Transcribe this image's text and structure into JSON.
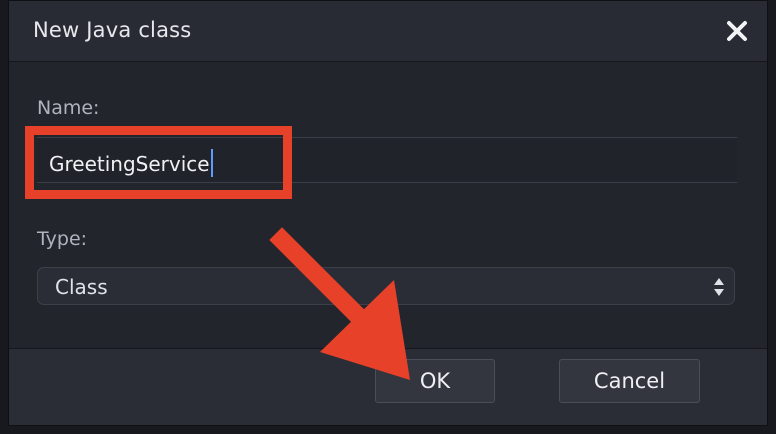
{
  "dialog": {
    "title": "New Java class",
    "close_icon": "close-icon"
  },
  "form": {
    "name_label": "Name:",
    "name_value": "GreetingService",
    "type_label": "Type:",
    "type_value": "Class",
    "type_icon": "select-arrows-icon"
  },
  "buttons": {
    "ok_label": "OK",
    "cancel_label": "Cancel"
  },
  "annotations": {
    "highlight_color": "#e7412a",
    "arrow_color": "#e7412a"
  }
}
